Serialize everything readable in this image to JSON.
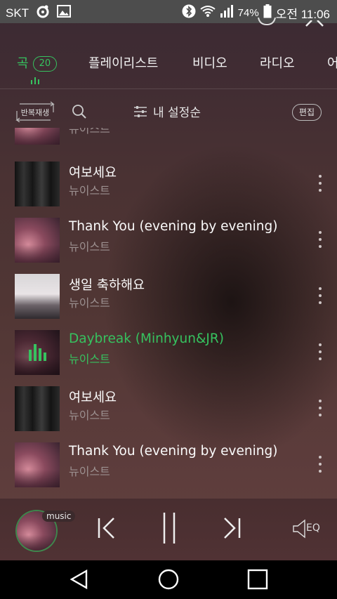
{
  "status_bar": {
    "carrier": "SKT",
    "battery": "74%",
    "time": "오전 11:06"
  },
  "tabs": [
    {
      "label": "곡",
      "count": "20",
      "active": true
    },
    {
      "label": "플레이리스트"
    },
    {
      "label": "비디오"
    },
    {
      "label": "라디오"
    },
    {
      "label": "어"
    }
  ],
  "toolbar": {
    "repeat_label": "반복재생",
    "sort_label": "내 설정순",
    "edit_label": "편집"
  },
  "songs": [
    {
      "title": "",
      "artist": "뉴이스트",
      "art": "pink"
    },
    {
      "title": "여보세요",
      "artist": "뉴이스트",
      "art": "dark"
    },
    {
      "title": "Thank You (evening by evening)",
      "artist": "뉴이스트",
      "art": "pink"
    },
    {
      "title": "생일 축하해요",
      "artist": "뉴이스트",
      "art": "white"
    },
    {
      "title": "Daybreak (Minhyun&JR)",
      "artist": "뉴이스트",
      "art": "pink",
      "playing": true
    },
    {
      "title": "여보세요",
      "artist": "뉴이스트",
      "art": "dark"
    },
    {
      "title": "Thank You (evening by evening)",
      "artist": "뉴이스트",
      "art": "pink"
    }
  ],
  "player": {
    "tag": "music",
    "eq_label": "EQ"
  },
  "colors": {
    "accent": "#36c25f"
  }
}
